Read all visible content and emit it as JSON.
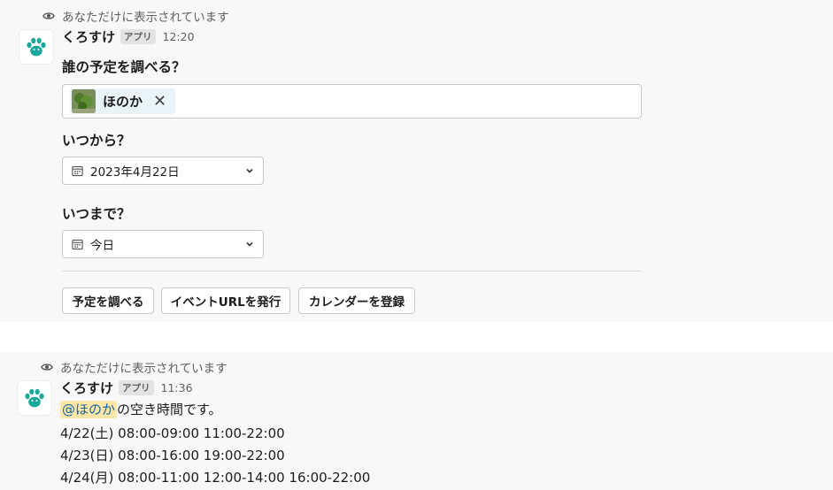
{
  "message1": {
    "ephemeral_note": "あなただけに表示されています",
    "bot_name": "くろすけ",
    "app_badge": "アプリ",
    "time": "12:20",
    "question_who": "誰の予定を調べる？",
    "selected_user": "ほのか",
    "question_from": "いつから？",
    "from_date": "2023年4月22日",
    "question_to": "いつまで？",
    "to_date": "今日",
    "buttons": {
      "check_schedule": "予定を調べる",
      "issue_event_url": "イベントURLを発行",
      "register_calendar": "カレンダーを登録"
    }
  },
  "message2": {
    "ephemeral_note": "あなただけに表示されています",
    "bot_name": "くろすけ",
    "app_badge": "アプリ",
    "time": "11:36",
    "mention": "@ほのか",
    "intro_rest": "の空き時間です。",
    "lines": [
      "4/22(土)  08:00-09:00 11:00-22:00",
      "4/23(日)  08:00-16:00 19:00-22:00",
      "4/24(月)  08:00-11:00 12:00-14:00 16:00-22:00"
    ]
  },
  "icons": {
    "eye": "eye-icon",
    "avatar": "paw-icon",
    "calendar": "calendar-icon",
    "chevron": "chevron-down-icon",
    "remove": "close-icon"
  },
  "colors": {
    "paw": "#1aa89a",
    "mention_bg": "#fce6a8",
    "mention_text": "#1264a3",
    "chip_bg": "#e8f3fa"
  }
}
